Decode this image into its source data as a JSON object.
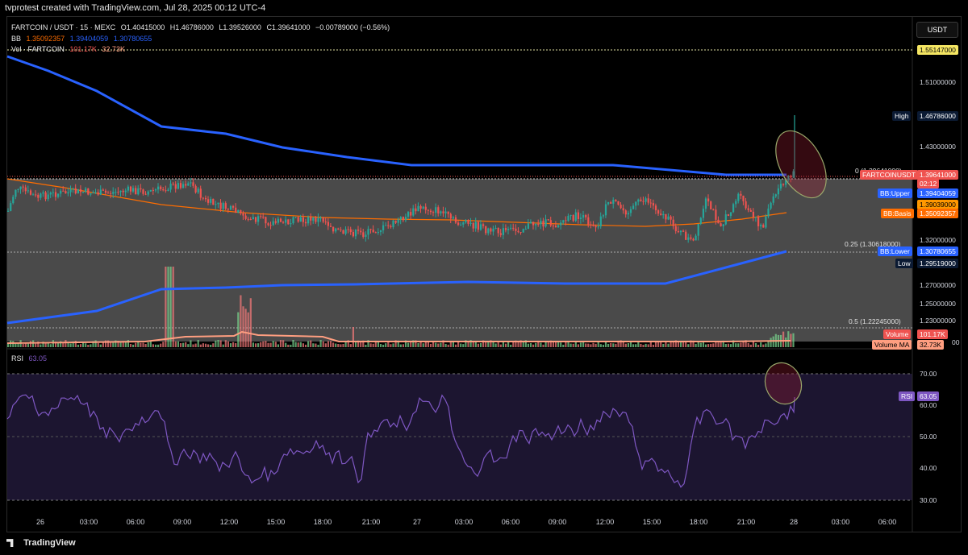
{
  "header": {
    "title": "tvprotest created with TradingView.com, Jul 28, 2025 00:12 UTC-4"
  },
  "legend": {
    "symbol": "FARTCOIN / USDT · 15 · MEXC",
    "open": "O1.40415000",
    "high": "H1.46786000",
    "low": "L1.39526000",
    "close": "C1.39641000",
    "change": "−0.00789000 (−0.56%)",
    "bb_label": "BB",
    "bb_basis": "1.35092357",
    "bb_upper": "1.39404059",
    "bb_lower": "1.30780655",
    "vol_label": "Vol · FARTCOIN",
    "vol_value": "101.17K",
    "vol_ma": "32.73K",
    "rsi_label": "RSI",
    "rsi_value": "63.05"
  },
  "currency_button": "USDT",
  "price_axis": {
    "ticks": [
      "1.51000000",
      "1.43000000",
      "1.32000000",
      "1.27000000",
      "1.25000000",
      "1.23000000"
    ],
    "top_level": "1.55147000"
  },
  "rsi_axis": {
    "ticks": [
      "70.00",
      "60.00",
      "50.00",
      "40.00",
      "30.00"
    ]
  },
  "tags": {
    "high_label": "High",
    "high_value": "1.46786000",
    "symbol_label": "FARTCOINUSDT",
    "symbol_value": "1.39641000",
    "countdown": "02:12",
    "bbupper_label": "BB:Upper",
    "bbupper_value": "1.39404059",
    "orange_value": "1.39039000",
    "bbbasis_label": "BB:Basis",
    "bbbasis_value": "1.35092357",
    "bblower_label": "BB:Lower",
    "bblower_value": "1.30780655",
    "low_label": "Low",
    "low_value": "1.29519000",
    "volume_label": "Volume",
    "volume_value": "101.17K",
    "volma_label": "Volume MA",
    "volma_value": "32.73K",
    "rsi_label": "RSI",
    "rsi_value": "63.05"
  },
  "fib": {
    "level0": "0 (1.39641000)",
    "level025": "0.25 (1.30618000)",
    "level05": "0.5 (1.22245000)"
  },
  "time_axis": [
    "26",
    "03:00",
    "06:00",
    "09:00",
    "12:00",
    "15:00",
    "18:00",
    "21:00",
    "27",
    "03:00",
    "06:00",
    "09:00",
    "12:00",
    "15:00",
    "18:00",
    "21:00",
    "28",
    "03:00",
    "06:00"
  ],
  "colors": {
    "up": "#26a69a",
    "down": "#ef5350",
    "bb": "#2962ff",
    "basis": "#ff6d00",
    "rsi": "#7e57c2",
    "vol_ma": "#ff9e80"
  },
  "brand": "TradingView"
}
